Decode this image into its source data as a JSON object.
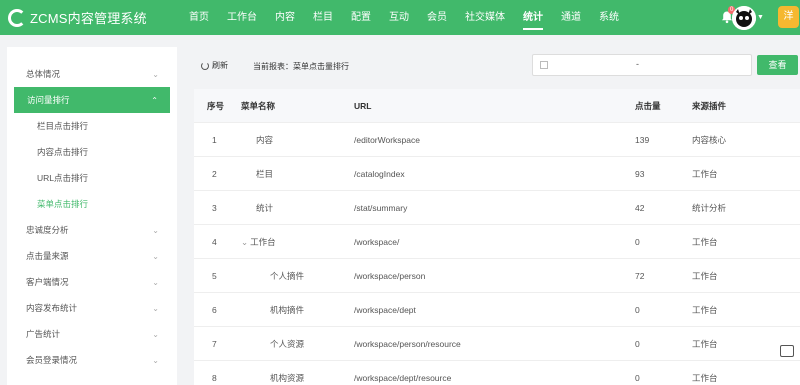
{
  "app": {
    "title": "ZCMS内容管理系统"
  },
  "nav": [
    "首页",
    "工作台",
    "内容",
    "栏目",
    "配置",
    "互动",
    "会员",
    "社交媒体",
    "统计",
    "通道",
    "系统"
  ],
  "nav_active": "统计",
  "header": {
    "notification_count": "0",
    "user_initial": "洋"
  },
  "sidebar": {
    "groups": [
      {
        "label": "总体情况"
      },
      {
        "label": "访问量排行"
      },
      {
        "label": "忠诚度分析"
      },
      {
        "label": "点击量来源"
      },
      {
        "label": "客户端情况"
      },
      {
        "label": "内容发布统计"
      },
      {
        "label": "广告统计"
      },
      {
        "label": "会员登录情况"
      }
    ],
    "subs": [
      {
        "label": "栏目点击排行"
      },
      {
        "label": "内容点击排行"
      },
      {
        "label": "URL点击排行"
      },
      {
        "label": "菜单点击排行"
      }
    ]
  },
  "toolbar": {
    "refresh_label": "刷新",
    "crumb": "当前报表：菜单点击量排行",
    "search_dash": "-",
    "query_label": "查看"
  },
  "table": {
    "columns": [
      "序号",
      "菜单名称",
      "URL",
      "点击量",
      "来源插件"
    ],
    "rows": [
      {
        "index": "1",
        "name": "内容",
        "url": "/editorWorkspace",
        "clicks": "139",
        "source": "内容核心"
      },
      {
        "index": "2",
        "name": "栏目",
        "url": "/catalogIndex",
        "clicks": "93",
        "source": "工作台"
      },
      {
        "index": "3",
        "name": "统计",
        "url": "/stat/summary",
        "clicks": "42",
        "source": "统计分析"
      },
      {
        "index": "4",
        "name": "工作台",
        "url": "/workspace/",
        "clicks": "0",
        "source": "工作台"
      },
      {
        "index": "5",
        "name": "个人摘件",
        "url": "/workspace/person",
        "clicks": "72",
        "source": "工作台"
      },
      {
        "index": "6",
        "name": "机构摘件",
        "url": "/workspace/dept",
        "clicks": "0",
        "source": "工作台"
      },
      {
        "index": "7",
        "name": "个人资源",
        "url": "/workspace/person/resource",
        "clicks": "0",
        "source": "工作台"
      },
      {
        "index": "8",
        "name": "机构资源",
        "url": "/workspace/dept/resource",
        "clicks": "0",
        "source": "工作台"
      }
    ]
  },
  "colors": {
    "brand": "#41b96b"
  },
  "icons": [
    "logo-icon",
    "bell-icon",
    "chevron-down-icon",
    "chevron-up-icon",
    "refresh-icon",
    "caret-down-icon",
    "inbox-icon"
  ]
}
